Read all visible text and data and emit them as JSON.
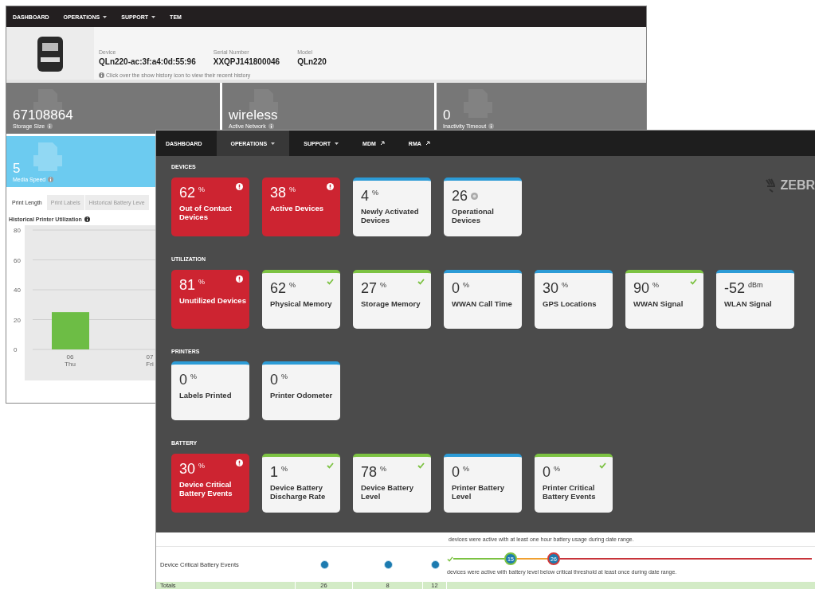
{
  "back_window": {
    "nav": [
      {
        "label": "DASHBOARD",
        "kind": "plain"
      },
      {
        "label": "OPERATIONS",
        "kind": "dropdown"
      },
      {
        "label": "SUPPORT",
        "kind": "dropdown"
      },
      {
        "label": "TEM",
        "kind": "plain"
      }
    ],
    "device": {
      "fields": [
        {
          "label": "Device",
          "value": "QLn220-ac:3f:a4:0d:55:96"
        },
        {
          "label": "Serial Number",
          "value": "XXQPJ141800046"
        },
        {
          "label": "Model",
          "value": "QLn220"
        }
      ],
      "note": "Click over the show history icon to view their recent history"
    },
    "stats": [
      {
        "value": "67108864",
        "label": "Storage Size",
        "highlight": false
      },
      {
        "value": "wireless",
        "label": "Active Network",
        "highlight": false
      },
      {
        "value": "0",
        "label": "Inactivity Timeout",
        "highlight": false
      },
      {
        "value": "5",
        "label": "Media Speed",
        "highlight": true
      }
    ],
    "tabs": [
      {
        "label": "Print Length",
        "selected": true
      },
      {
        "label": "Print Labels",
        "selected": false
      },
      {
        "label": "Historical Battery Leve",
        "selected": false
      }
    ],
    "chart_title": "Historical Printer Utilization",
    "chart_data": {
      "type": "bar",
      "categories": [
        "06 Thu",
        "07 Fri"
      ],
      "values": [
        25,
        null
      ],
      "grid": true,
      "ylim": [
        0,
        80
      ],
      "yticks": [
        0,
        20,
        40,
        60,
        80
      ]
    }
  },
  "front_window": {
    "nav": [
      {
        "label": "DASHBOARD",
        "kind": "plain",
        "selected": false
      },
      {
        "label": "OPERATIONS",
        "kind": "dropdown",
        "selected": true
      },
      {
        "label": "SUPPORT",
        "kind": "dropdown",
        "selected": false
      },
      {
        "label": "MDM",
        "kind": "external",
        "selected": false
      },
      {
        "label": "RMA",
        "kind": "external",
        "selected": false
      }
    ],
    "logo": "ZEBR",
    "sections": [
      {
        "title": "DEVICES",
        "tiles": [
          {
            "value": "62",
            "unit": "%",
            "label": "Out of Contact Devices",
            "kind": "alert"
          },
          {
            "value": "38",
            "unit": "%",
            "label": "Active Devices",
            "kind": "alert"
          },
          {
            "value": "4",
            "unit": "%",
            "label": "Newly Activated Devices",
            "kind": "info"
          },
          {
            "value": "26",
            "label": "Operational Devices",
            "kind": "info",
            "badge": true
          }
        ]
      },
      {
        "title": "UTILIZATION",
        "tiles": [
          {
            "value": "81",
            "unit": "%",
            "label": "Unutilized Devices",
            "kind": "alert"
          },
          {
            "value": "62",
            "unit": "%",
            "label": "Physical Memory",
            "kind": "ok"
          },
          {
            "value": "27",
            "unit": "%",
            "label": "Storage Memory",
            "kind": "ok"
          },
          {
            "value": "0",
            "unit": "%",
            "label": "WWAN Call Time",
            "kind": "info"
          },
          {
            "value": "30",
            "unit": "%",
            "label": "GPS Locations",
            "kind": "info"
          },
          {
            "value": "90",
            "unit": "%",
            "label": "WWAN Signal",
            "kind": "ok"
          },
          {
            "value": "-52",
            "unit": "dBm",
            "label": "WLAN Signal",
            "kind": "info"
          }
        ]
      },
      {
        "title": "PRINTERS",
        "tiles": [
          {
            "value": "0",
            "unit": "%",
            "label": "Labels Printed",
            "kind": "info"
          },
          {
            "value": "0",
            "unit": "%",
            "label": "Printer Odometer",
            "kind": "info"
          }
        ]
      },
      {
        "title": "BATTERY",
        "tiles": [
          {
            "value": "30",
            "unit": "%",
            "label": "Device Critical Battery Events",
            "kind": "alert"
          },
          {
            "value": "1",
            "unit": "%",
            "label": "Device Battery Discharge Rate",
            "kind": "ok"
          },
          {
            "value": "78",
            "unit": "%",
            "label": "Device Battery Level",
            "kind": "ok"
          },
          {
            "value": "0",
            "unit": "%",
            "label": "Printer Battery Level",
            "kind": "info"
          },
          {
            "value": "0",
            "unit": "%",
            "label": "Printer Critical Battery Events",
            "kind": "ok"
          }
        ]
      }
    ],
    "table": {
      "note": "devices were active with at least one hour battery usage during date range.",
      "row": {
        "label": "Device Critical Battery Events",
        "markers": [
          "15",
          "26"
        ],
        "description": "devices were active with battery level below critical threshold at least once during date range."
      },
      "totals": [
        "Totals",
        "26",
        "8",
        "12"
      ]
    }
  }
}
